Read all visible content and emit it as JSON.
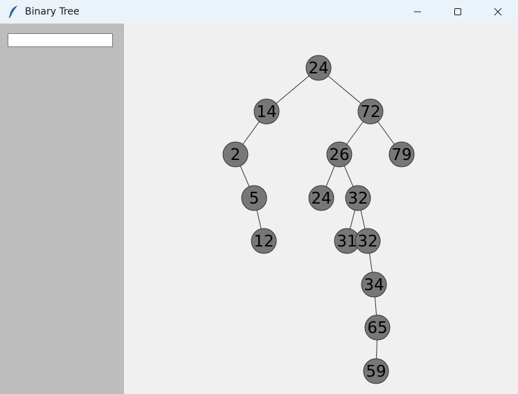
{
  "window": {
    "title": "Binary Tree",
    "app_icon": "feather-icon",
    "controls": [
      "minimize-icon",
      "maximize-icon",
      "close-icon"
    ]
  },
  "sidebar": {
    "input_value": "",
    "input_placeholder": ""
  },
  "tree": {
    "node_color": "#777777",
    "node_border": "#333333",
    "edge_color": "#333333",
    "nodes": [
      {
        "id": "n1",
        "value": "24"
      },
      {
        "id": "n2",
        "value": "14"
      },
      {
        "id": "n3",
        "value": "72"
      },
      {
        "id": "n4",
        "value": "2"
      },
      {
        "id": "n5",
        "value": "26"
      },
      {
        "id": "n6",
        "value": "79"
      },
      {
        "id": "n7",
        "value": "5"
      },
      {
        "id": "n8",
        "value": "24"
      },
      {
        "id": "n9",
        "value": "32"
      },
      {
        "id": "n10",
        "value": "12"
      },
      {
        "id": "n11",
        "value": "31"
      },
      {
        "id": "n12",
        "value": "32"
      },
      {
        "id": "n13",
        "value": "34"
      },
      {
        "id": "n14",
        "value": "65"
      },
      {
        "id": "n15",
        "value": "59"
      }
    ],
    "edges": [
      [
        "n1",
        "n2"
      ],
      [
        "n1",
        "n3"
      ],
      [
        "n2",
        "n4"
      ],
      [
        "n3",
        "n5"
      ],
      [
        "n3",
        "n6"
      ],
      [
        "n4",
        "n7"
      ],
      [
        "n5",
        "n8"
      ],
      [
        "n5",
        "n9"
      ],
      [
        "n7",
        "n10"
      ],
      [
        "n9",
        "n11"
      ],
      [
        "n9",
        "n12"
      ],
      [
        "n12",
        "n13"
      ],
      [
        "n13",
        "n14"
      ],
      [
        "n14",
        "n15"
      ]
    ]
  }
}
